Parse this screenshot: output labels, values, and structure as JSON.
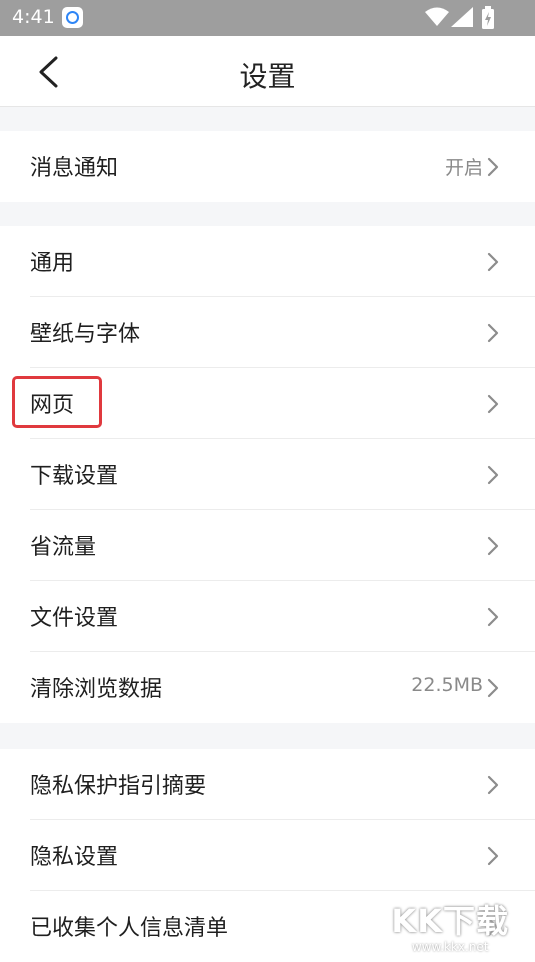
{
  "status_bar": {
    "time": "4:41"
  },
  "header": {
    "title": "设置"
  },
  "groups": [
    {
      "rows": [
        {
          "label": "消息通知",
          "value": "开启"
        }
      ]
    },
    {
      "rows": [
        {
          "label": "通用"
        },
        {
          "label": "壁纸与字体"
        },
        {
          "label": "网页"
        },
        {
          "label": "下载设置"
        },
        {
          "label": "省流量"
        },
        {
          "label": "文件设置"
        },
        {
          "label": "清除浏览数据",
          "value": "22.5MB"
        }
      ]
    },
    {
      "rows": [
        {
          "label": "隐私保护指引摘要"
        },
        {
          "label": "隐私设置"
        },
        {
          "label": "已收集个人信息清单"
        }
      ]
    }
  ],
  "annotation": {
    "color": "#e0393e",
    "target": "网页"
  },
  "watermark": {
    "brand": "KK下载",
    "url": "www.kkx.net"
  }
}
